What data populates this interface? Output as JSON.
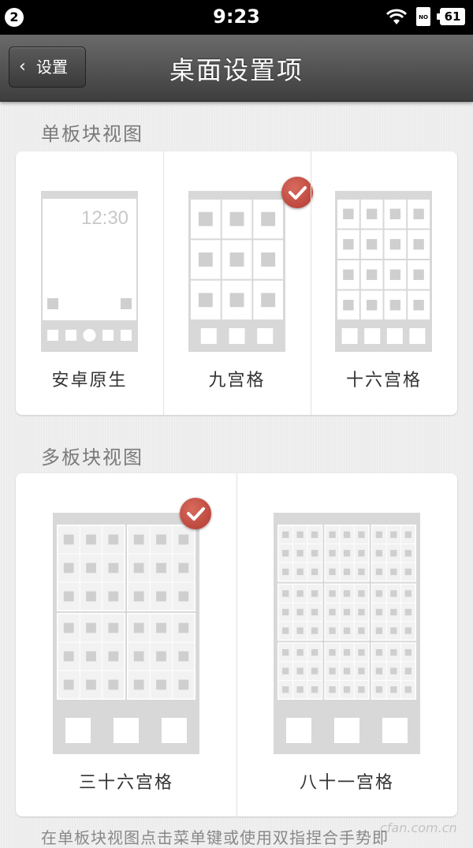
{
  "status_bar": {
    "notification_count": "2",
    "time": "9:23",
    "sim_label": "NO",
    "battery": "61"
  },
  "header": {
    "back_label": "设置",
    "title": "桌面设置项"
  },
  "single_panel": {
    "section_title": "单板块视图",
    "options": [
      {
        "label": "安卓原生",
        "preview_clock": "12:30",
        "selected": false
      },
      {
        "label": "九宫格",
        "selected": true
      },
      {
        "label": "十六宫格",
        "selected": false
      }
    ]
  },
  "multi_panel": {
    "section_title": "多板块视图",
    "options": [
      {
        "label": "三十六宫格",
        "selected": true
      },
      {
        "label": "八十一宫格",
        "selected": false
      }
    ]
  },
  "footnote": "在单板块视图点击菜单键或使用双指捏合手势即",
  "watermark": "cfan.com.cn",
  "colors": {
    "check_red": "#c0463c",
    "preview_gray": "#d8d8d8",
    "preview_tile": "#cfcfcf"
  }
}
